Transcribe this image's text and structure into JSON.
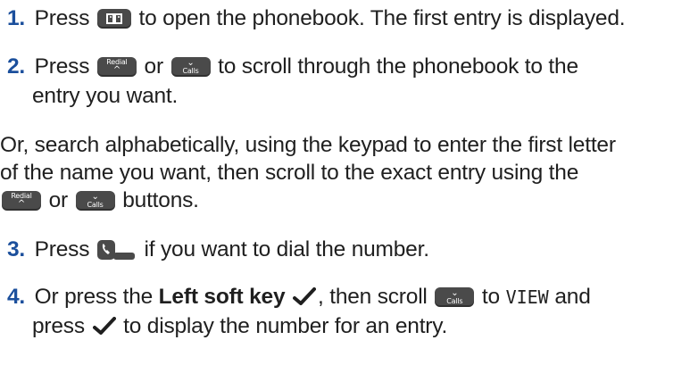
{
  "colors": {
    "step_number": "#1b4f9c",
    "key_background": "#4a4a4a",
    "text": "#1f1f1f"
  },
  "icons": {
    "phonebook_key": "book-icon",
    "redial_key": "redial-up-key-icon",
    "calls_key": "calls-down-key-icon",
    "talk_key": "phone-handset-icon",
    "check": "checkmark-icon"
  },
  "keys": {
    "redial_label": "Redial",
    "calls_label": "Calls",
    "up_arrow": "^",
    "down_arrow": "⌄"
  },
  "steps": [
    {
      "number": "1.",
      "part1": "Press",
      "part2": "to open the phonebook. The first entry is displayed."
    },
    {
      "number": "2.",
      "part1": "Press",
      "part2": "or",
      "part3": "to scroll through the phonebook to the",
      "line2": "entry you want."
    },
    {
      "number": "3.",
      "part1": "Press",
      "part2": "if you want to dial the number."
    },
    {
      "number": "4.",
      "part1": "Or press the",
      "bold": "Left soft key",
      "part2": ", then scroll",
      "part3": "to",
      "mono": "VIEW",
      "part4": "and",
      "line2_part1": "press",
      "line2_part2": "to display the number for an entry."
    }
  ],
  "search_note": {
    "line1": "Or, search alphabetically, using the keypad to enter the first letter",
    "line2": "of the name you want, then scroll to the exact entry using the",
    "line3_or": "or",
    "line3_end": "buttons."
  }
}
